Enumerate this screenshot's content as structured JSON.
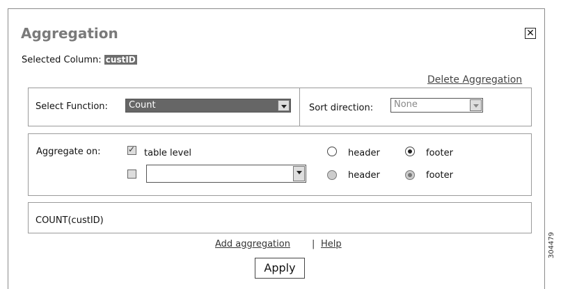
{
  "dialog": {
    "title": "Aggregation",
    "close_icon": "close-icon",
    "selected_column_label": "Selected Column:",
    "selected_column_value": "custID",
    "delete_link": "Delete Aggregation"
  },
  "function_panel": {
    "function_label": "Select Function:",
    "function_value": "Count",
    "sort_label": "Sort direction:",
    "sort_value": "None"
  },
  "aggregate_panel": {
    "label": "Aggregate on:",
    "rows": [
      {
        "checked": true,
        "text": "table level",
        "header_label": "header",
        "footer_label": "footer",
        "selected": "footer"
      },
      {
        "checked": false,
        "dropdown_value": "",
        "header_label": "header",
        "footer_label": "footer",
        "selected": "footer"
      }
    ]
  },
  "expression": "COUNT(custID)",
  "footer_links": {
    "add": "Add aggregation",
    "separator": "|",
    "help": "Help"
  },
  "apply_label": "Apply",
  "figure_number": "304479"
}
